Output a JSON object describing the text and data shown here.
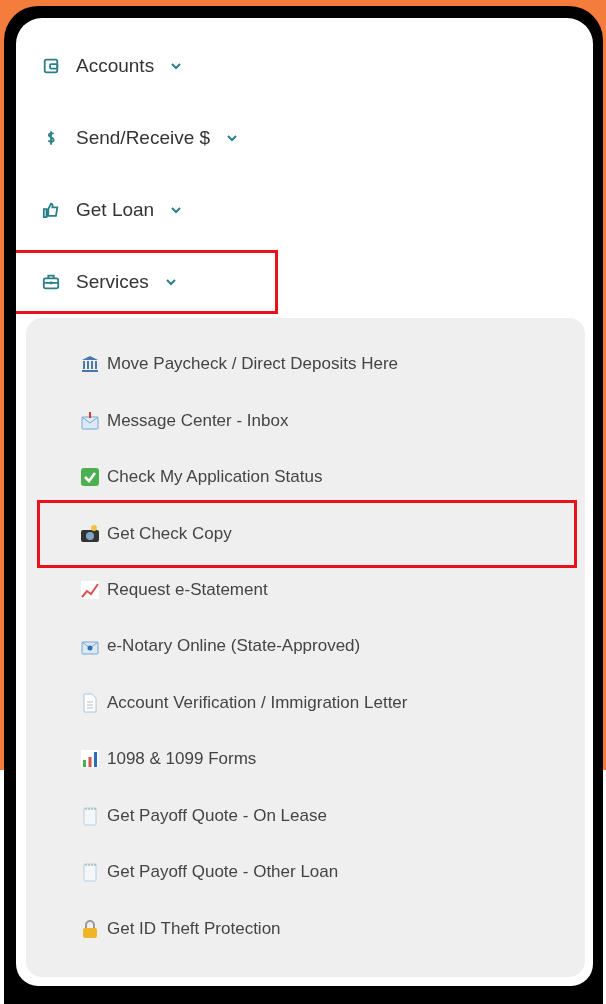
{
  "menu": [
    {
      "label": "Accounts",
      "highlighted": false
    },
    {
      "label": "Send/Receive $",
      "highlighted": false
    },
    {
      "label": "Get Loan",
      "highlighted": false
    },
    {
      "label": "Services",
      "highlighted": true,
      "children": [
        {
          "label": "Move Paycheck / Direct Deposits Here",
          "highlighted": false
        },
        {
          "label": "Message Center - Inbox",
          "highlighted": false
        },
        {
          "label": "Check My Application Status",
          "highlighted": false
        },
        {
          "label": "Get Check Copy",
          "highlighted": true
        },
        {
          "label": "Request e-Statement",
          "highlighted": false
        },
        {
          "label": "e-Notary Online (State-Approved)",
          "highlighted": false
        },
        {
          "label": "Account Verification / Immigration Letter",
          "highlighted": false
        },
        {
          "label": "1098 & 1099 Forms",
          "highlighted": false
        },
        {
          "label": "Get Payoff Quote - On Lease",
          "highlighted": false
        },
        {
          "label": "Get Payoff Quote - Other Loan",
          "highlighted": false
        },
        {
          "label": "Get ID Theft Protection",
          "highlighted": false
        }
      ]
    }
  ]
}
